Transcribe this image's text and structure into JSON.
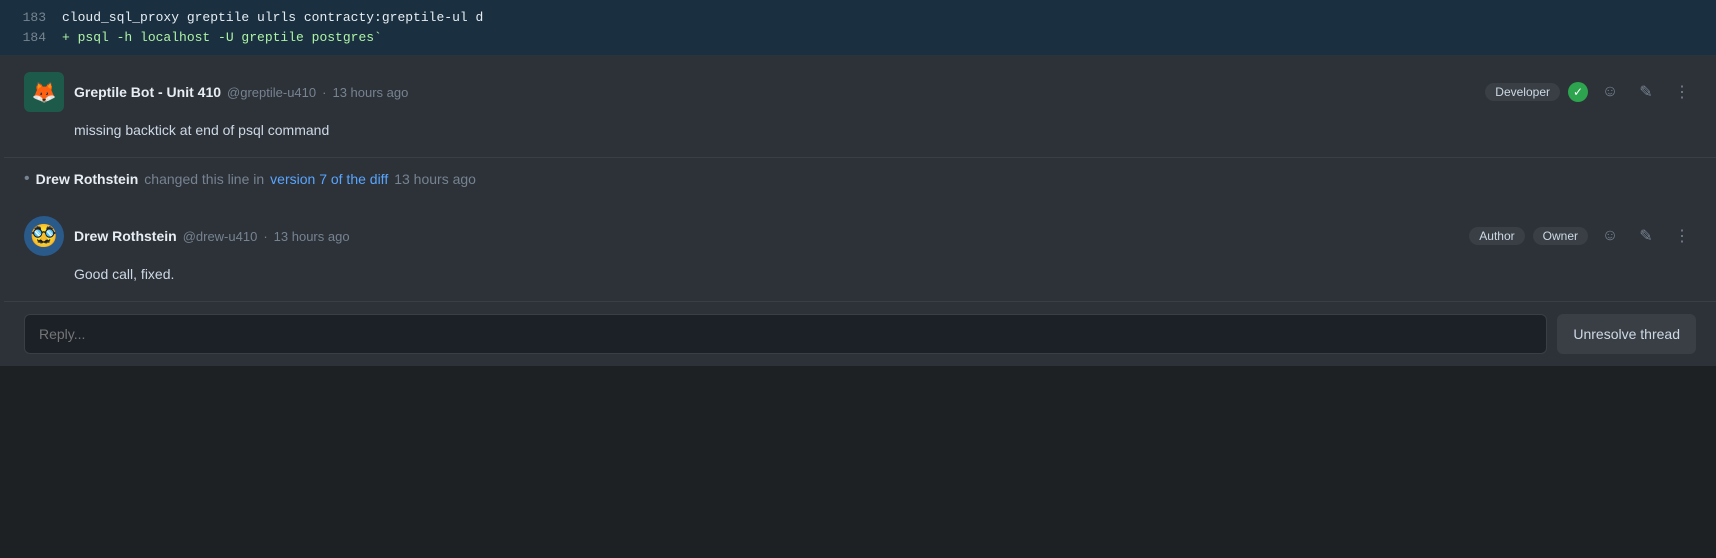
{
  "code": {
    "line_number": "184",
    "prefix": "+ psql -h localhost -U greptile postgres`",
    "line_above_number": "183",
    "line_above_content": "cloud_sql_proxy greptile ulrls contracty:greptile-ul d"
  },
  "comments": [
    {
      "id": "bot-comment",
      "avatar_emoji": "🦊",
      "author": "Greptile Bot - Unit 410",
      "username": "@greptile-u410",
      "time": "13 hours ago",
      "badge": "Developer",
      "body": "missing backtick at end of psql command",
      "has_check": true
    },
    {
      "id": "user-comment",
      "avatar_emoji": "🥸",
      "author": "Drew Rothstein",
      "username": "@drew-u410",
      "time": "13 hours ago",
      "badges": [
        "Author",
        "Owner"
      ],
      "body": "Good call, fixed."
    }
  ],
  "change_line": {
    "author": "Drew Rothstein",
    "text": "changed this line in",
    "link_text": "version 7 of the diff",
    "time": "13 hours ago"
  },
  "reply": {
    "placeholder": "Reply..."
  },
  "unresolve_button": "Unresolve thread",
  "icons": {
    "emoji": "☺",
    "edit": "✎",
    "more": "⋮",
    "check": "✓"
  }
}
